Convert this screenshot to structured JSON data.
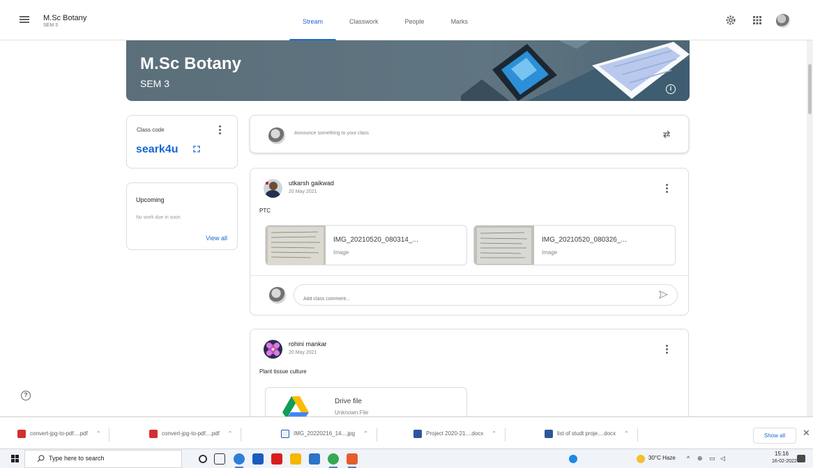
{
  "header": {
    "class_name": "M.Sc Botany",
    "section": "SEM 3",
    "tabs": [
      {
        "label": "Stream",
        "active": true
      },
      {
        "label": "Classwork",
        "active": false
      },
      {
        "label": "People",
        "active": false
      },
      {
        "label": "Marks",
        "active": false
      }
    ],
    "icons": [
      "menu-icon",
      "gear-icon",
      "apps-icon",
      "avatar"
    ]
  },
  "banner": {
    "title": "M.Sc Botany",
    "subtitle": "SEM 3",
    "background_color": "#5e7380"
  },
  "class_code": {
    "label": "Class code",
    "value": "seark4u"
  },
  "upcoming": {
    "title": "Upcoming",
    "message": "No work due in soon",
    "view_all": "View all"
  },
  "announce": {
    "placeholder": "Announce something to your class"
  },
  "posts": [
    {
      "author": "utkarsh gaikwad",
      "date": "20 May 2021",
      "text": "PTC",
      "attachments": [
        {
          "name": "IMG_20210520_080314_...",
          "kind": "Image"
        },
        {
          "name": "IMG_20210520_080326_...",
          "kind": "Image"
        }
      ],
      "comment_placeholder": "Add class comment..."
    },
    {
      "author": "rohini mankar",
      "date": "20 May 2021",
      "text": "Plant tissue culture",
      "attachments": [
        {
          "name": "Drive file",
          "kind": "Unknown File"
        }
      ]
    }
  ],
  "downloads": {
    "items": [
      {
        "name": "convert-jpg-to-pdf....pdf",
        "icon": "pdf-icon"
      },
      {
        "name": "convert-jpg-to-pdf....pdf",
        "icon": "pdf-icon"
      },
      {
        "name": "IMG_20220216_14....jpg",
        "icon": "image-icon"
      },
      {
        "name": "Project 2020-21....docx",
        "icon": "word-icon"
      },
      {
        "name": "list of studt proje....docx",
        "icon": "word-icon"
      }
    ],
    "show_all": "Show all"
  },
  "taskbar": {
    "search_placeholder": "Type here to search",
    "weather": "30°C Haze",
    "time": "15:16",
    "date": "16-02-2022"
  },
  "colors": {
    "accent": "#1967d2",
    "banner": "#5e7380",
    "text": "#3c4043",
    "border": "#dadce0"
  }
}
